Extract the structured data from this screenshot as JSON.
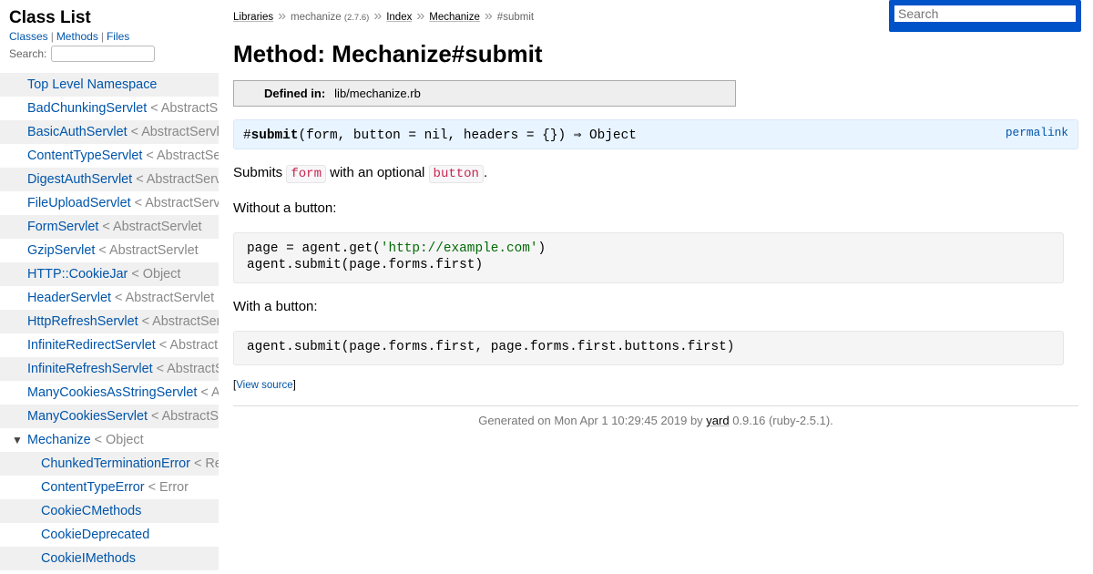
{
  "sidebar": {
    "title": "Class List",
    "nav": [
      "Classes",
      "Methods",
      "Files"
    ],
    "search_label": "Search:",
    "items": [
      {
        "name": "Top Level Namespace",
        "super": ""
      },
      {
        "name": "BadChunkingServlet",
        "super": "< AbstractServlet"
      },
      {
        "name": "BasicAuthServlet",
        "super": "< AbstractServlet"
      },
      {
        "name": "ContentTypeServlet",
        "super": "< AbstractServlet"
      },
      {
        "name": "DigestAuthServlet",
        "super": "< AbstractServlet"
      },
      {
        "name": "FileUploadServlet",
        "super": "< AbstractServlet"
      },
      {
        "name": "FormServlet",
        "super": "< AbstractServlet"
      },
      {
        "name": "GzipServlet",
        "super": "< AbstractServlet"
      },
      {
        "name": "HTTP::CookieJar",
        "super": "< Object"
      },
      {
        "name": "HeaderServlet",
        "super": "< AbstractServlet"
      },
      {
        "name": "HttpRefreshServlet",
        "super": "< AbstractServlet"
      },
      {
        "name": "InfiniteRedirectServlet",
        "super": "< AbstractServlet"
      },
      {
        "name": "InfiniteRefreshServlet",
        "super": "< AbstractServlet"
      },
      {
        "name": "ManyCookiesAsStringServlet",
        "super": "< AbstractServlet"
      },
      {
        "name": "ManyCookiesServlet",
        "super": "< AbstractServlet"
      },
      {
        "name": "Mechanize",
        "super": "< Object",
        "toggle": "▼"
      },
      {
        "name": "ChunkedTerminationError",
        "super": "< ResponseReadError"
      },
      {
        "name": "ContentTypeError",
        "super": "< Error"
      },
      {
        "name": "CookieCMethods",
        "super": ""
      },
      {
        "name": "CookieDeprecated",
        "super": ""
      },
      {
        "name": "CookieIMethods",
        "super": ""
      }
    ]
  },
  "breadcrumb": {
    "libraries": "Libraries",
    "sep": "»",
    "library": "mechanize",
    "version": "(2.7.6)",
    "index": "Index",
    "mechanize": "Mechanize",
    "current": "#submit"
  },
  "search": {
    "placeholder": "Search"
  },
  "main": {
    "title": "Method: Mechanize#submit",
    "defined_in_label": "Defined in:",
    "defined_in_value": "lib/mechanize.rb",
    "signature_prefix": "#",
    "signature_name": "submit",
    "signature_args": "(form, button = nil, headers = {}) ⇒ Object",
    "permalink": "permalink",
    "desc_pre": "Submits ",
    "desc_code1": "form",
    "desc_mid": " with an optional ",
    "desc_code2": "button",
    "desc_post": ".",
    "without_label": "Without a button:",
    "code1_line1_pre": "page = agent.get(",
    "code1_line1_str": "'http://example.com'",
    "code1_line1_post": ")",
    "code1_line2": "agent.submit(page.forms.first)",
    "with_label": "With a button:",
    "code2_line1": "agent.submit(page.forms.first, page.forms.first.buttons.first)",
    "view_source_open": "[",
    "view_source": "View source",
    "view_source_close": "]"
  },
  "footer": {
    "pre": "Generated on Mon Apr 1 10:29:45 2019 by ",
    "link": "yard",
    "post": " 0.9.16 (ruby-2.5.1)."
  }
}
